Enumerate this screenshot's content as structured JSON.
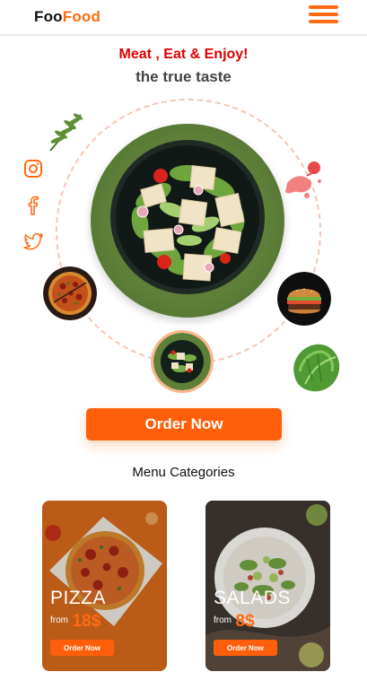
{
  "navbar": {
    "logo_part1": "Foo",
    "logo_part2": "Food",
    "menu_icon": "hamburger-menu-icon"
  },
  "hero": {
    "tagline": "Meat , Eat & Enjoy!",
    "subtitle": "the true taste",
    "dish_image": "salad-bowl",
    "thumbnails": [
      "pizza",
      "salad",
      "burger"
    ]
  },
  "social": {
    "icons": [
      "instagram-icon",
      "facebook-icon",
      "twitter-icon"
    ]
  },
  "cta": {
    "order_label": "Order Now"
  },
  "menu": {
    "heading": "Menu Categories",
    "categories": [
      {
        "name": "PIZZA",
        "from_label": "from",
        "price": "18$",
        "button_label": "Order Now"
      },
      {
        "name": "SALADS",
        "from_label": "from",
        "price": "8$",
        "button_label": "Order Now"
      }
    ]
  },
  "colors": {
    "accent": "#ff6a13",
    "tagline": "#e20000",
    "subtitle": "#444444"
  }
}
